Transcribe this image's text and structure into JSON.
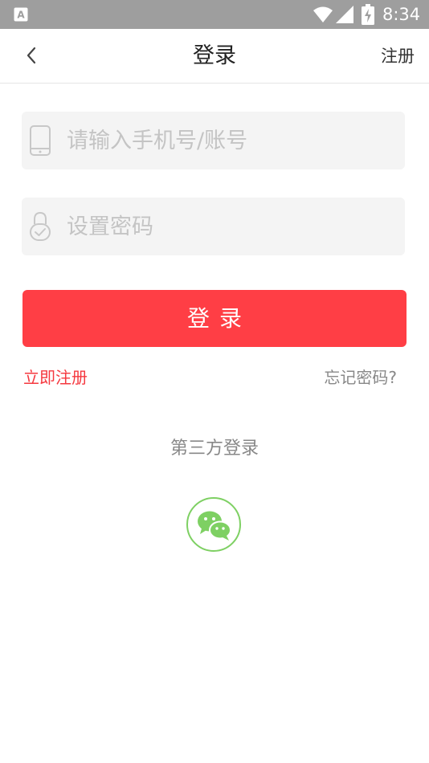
{
  "status_bar": {
    "app_icon": "a-letter-icon",
    "time": "8:34",
    "icons": [
      "wifi-icon",
      "signal-icon",
      "battery-charging-icon"
    ]
  },
  "nav": {
    "back_icon": "chevron-left-icon",
    "title": "登录",
    "register_label": "注册"
  },
  "form": {
    "phone": {
      "icon": "phone-icon",
      "placeholder": "请输入手机号/账号",
      "value": ""
    },
    "password": {
      "icon": "lock-icon",
      "placeholder": "设置密码",
      "value": ""
    },
    "login_label": "登录"
  },
  "links": {
    "register_now": "立即注册",
    "forgot_password": "忘记密码?"
  },
  "third_party": {
    "title": "第三方登录",
    "providers": [
      {
        "name_icon": "wechat-icon"
      }
    ]
  },
  "colors": {
    "status_bar": "#9e9e9e",
    "accent": "#ff3e45",
    "link_red": "#f5383f",
    "input_bg": "#f4f4f4",
    "wechat_green": "#7ed063"
  }
}
